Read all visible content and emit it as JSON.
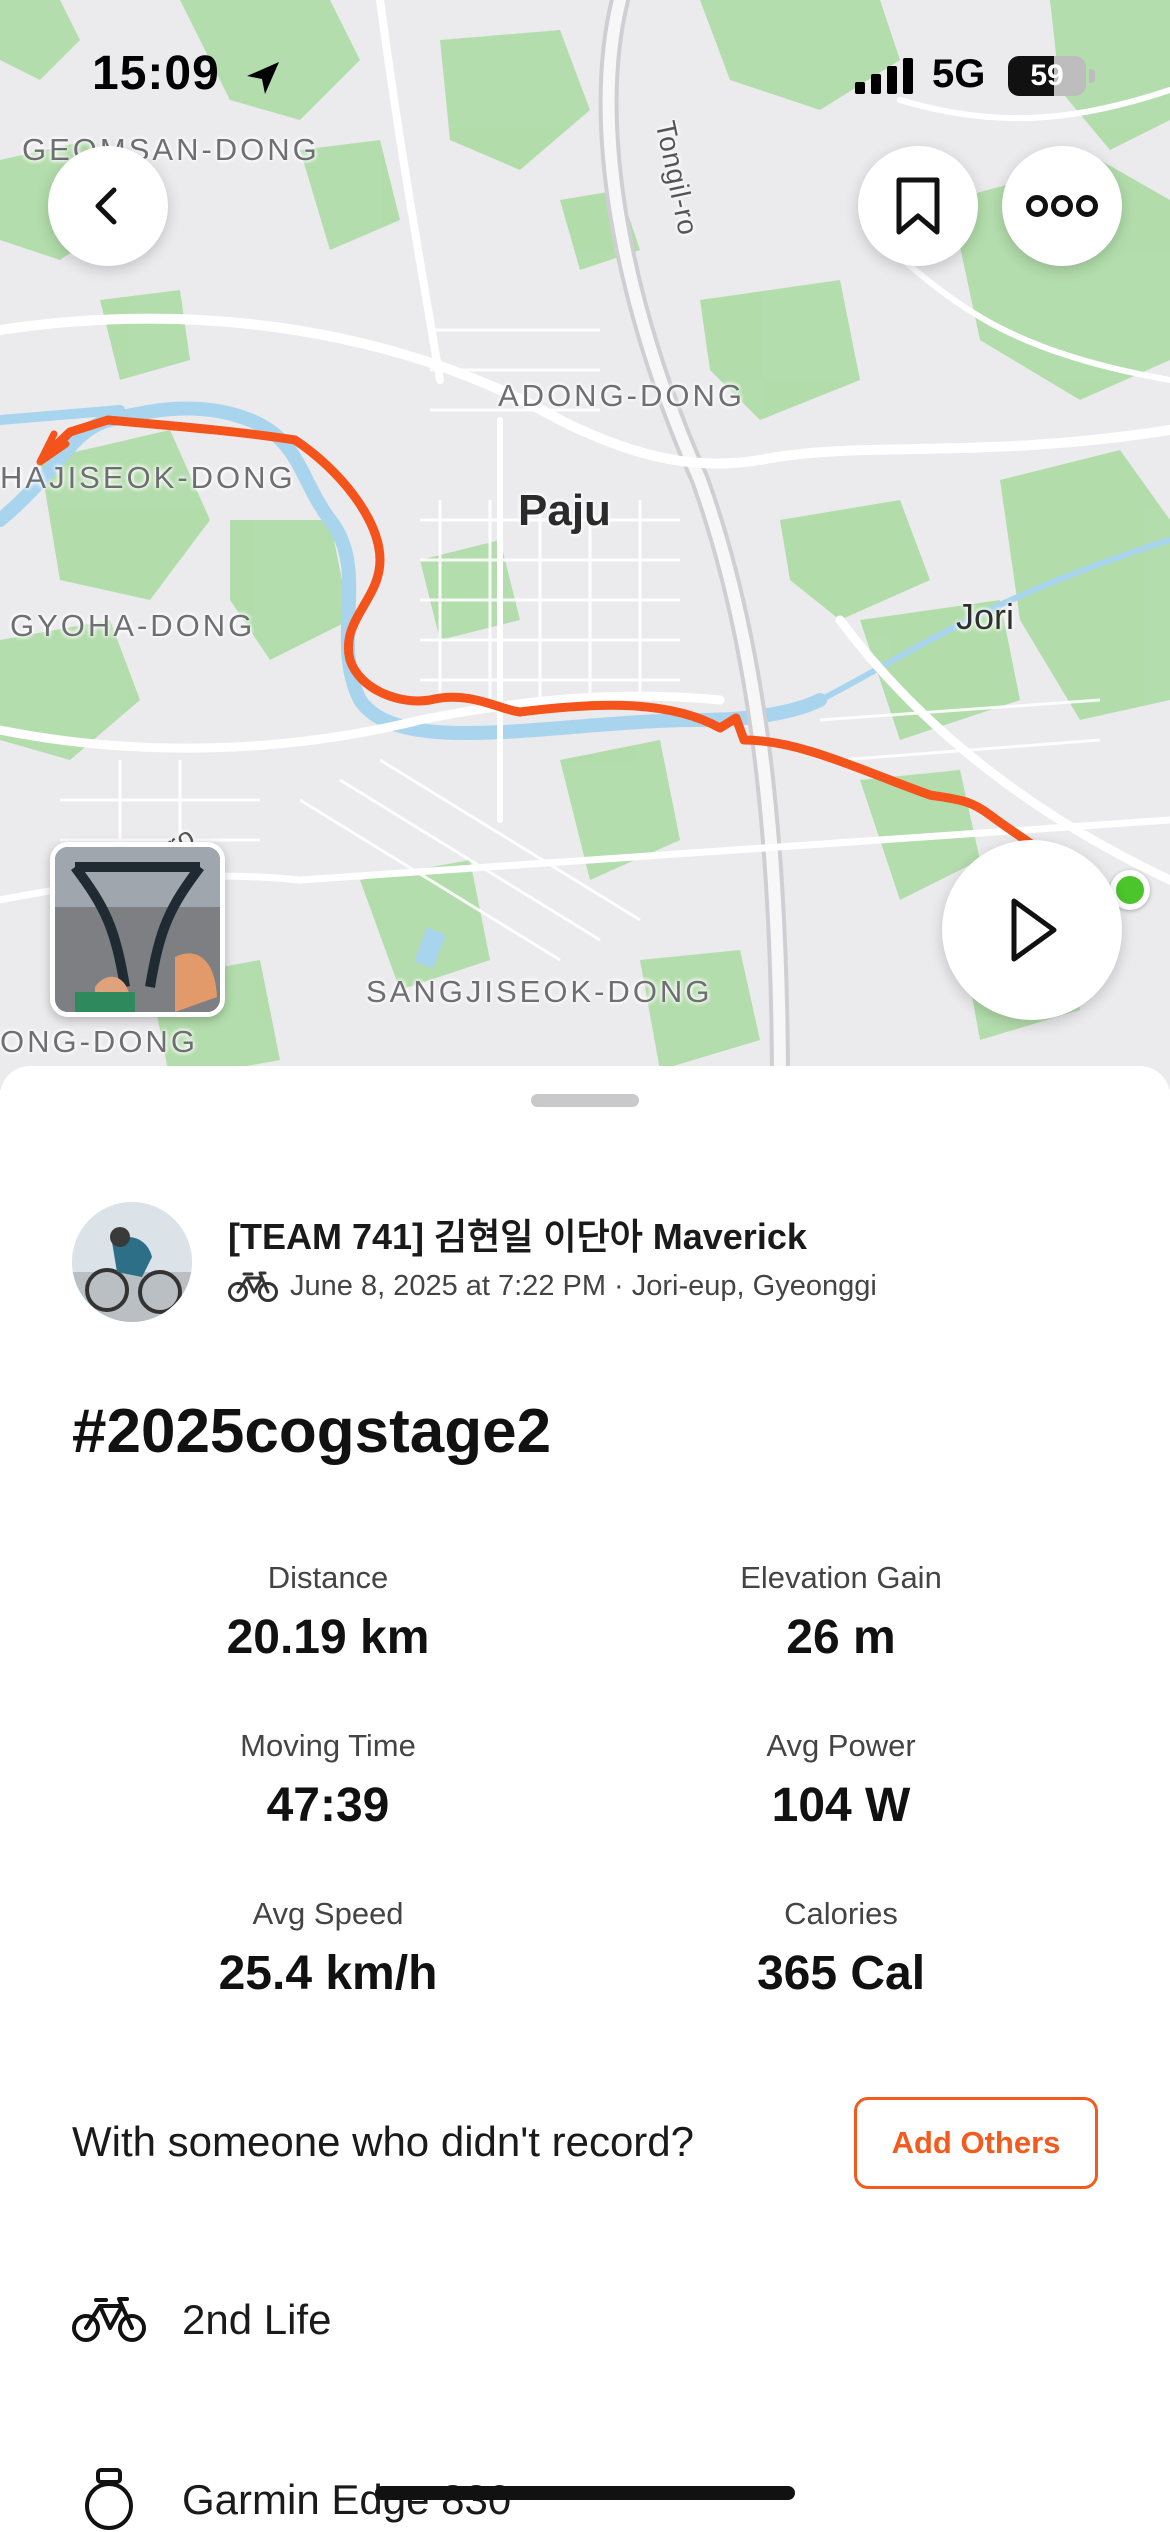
{
  "status_bar": {
    "time": "15:09",
    "network": "5G",
    "battery_level": "59",
    "battery_fraction": 0.59
  },
  "map": {
    "places": {
      "geomsan": "GEOMSAN-DONG",
      "adong": "ADONG-DONG",
      "paju": "Paju",
      "hajiseok": "HAJISEOK-DONG",
      "gyoha": "GYOHA-DONG",
      "jori": "Jori",
      "sangjiseok": "SANGJISEOK-DONG",
      "ong": "ONG-DONG",
      "tongil": "Tongil-ro",
      "iro": "il-ro"
    },
    "route_color": "#f4531b",
    "end_color": "#4cc52d"
  },
  "activity": {
    "athlete": "[TEAM 741] 김현일 이단아 Maverick",
    "meta": "June 8, 2025 at 7:22 PM · Jori-eup, Gyeonggi",
    "title": "#2025cogstage2",
    "stats": [
      {
        "label": "Distance",
        "value": "20.19 km"
      },
      {
        "label": "Elevation Gain",
        "value": "26 m"
      },
      {
        "label": "Moving Time",
        "value": "47:39"
      },
      {
        "label": "Avg Power",
        "value": "104 W"
      },
      {
        "label": "Avg Speed",
        "value": "25.4 km/h"
      },
      {
        "label": "Calories",
        "value": "365 Cal"
      }
    ],
    "with_prompt": "With someone who didn't record?",
    "add_others_label": "Add Others",
    "bike": "2nd Life",
    "device": "Garmin Edge 830"
  },
  "icons": {
    "back": "chevron-left-icon",
    "save": "bookmark-icon",
    "more": "more-dots-icon",
    "play": "play-icon",
    "bike": "bicycle-icon",
    "device": "watch-icon"
  },
  "accent_color": "#f25a1e"
}
